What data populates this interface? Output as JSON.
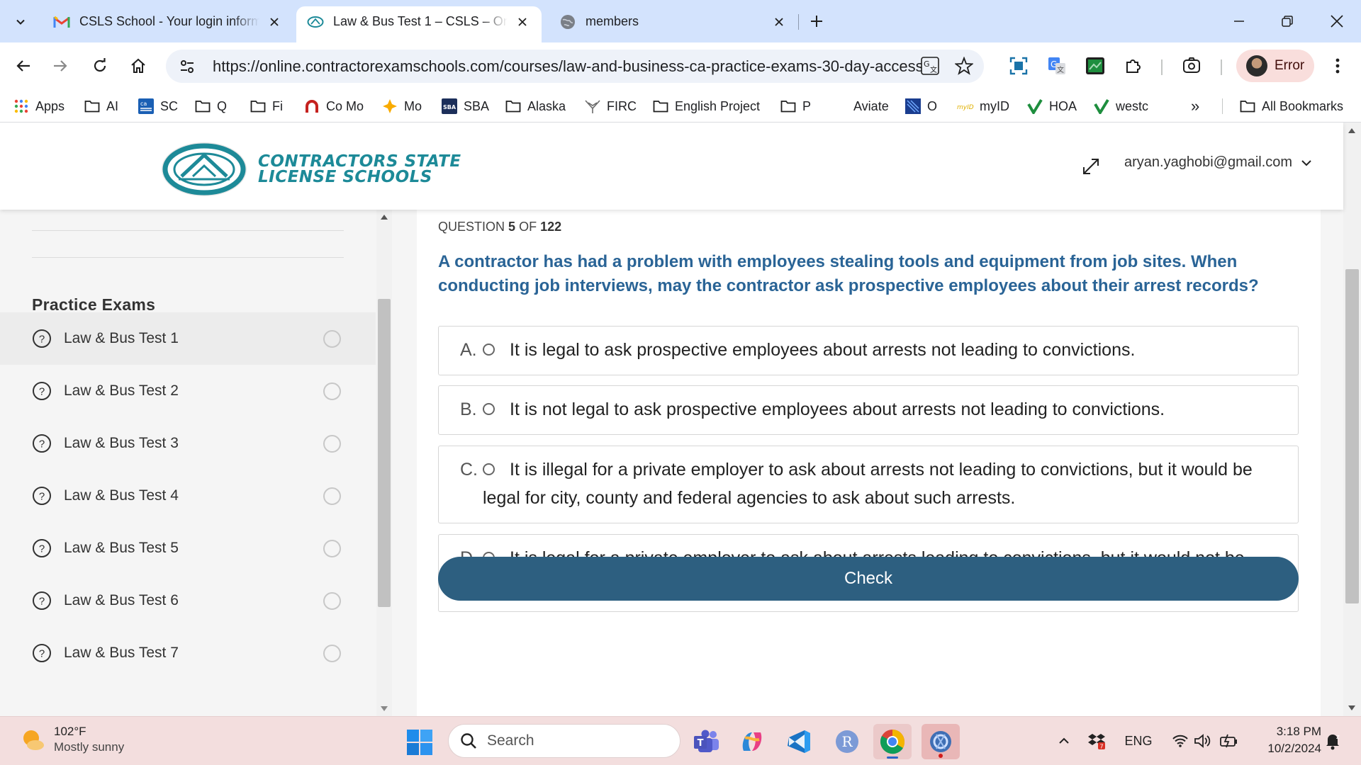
{
  "browser": {
    "tabs": [
      {
        "title": "CSLS School - Your login information"
      },
      {
        "title": "Law & Bus Test 1 – CSLS – Online"
      },
      {
        "title": "members"
      }
    ],
    "url": "https://online.contractorexamschools.com/courses/law-and-business-ca-practice-exams-30-day-access-2...",
    "profile_label": "Error",
    "bookmarks": [
      {
        "label": "Apps",
        "icon": "apps-grid-icon"
      },
      {
        "label": "AI",
        "icon": "folder-icon"
      },
      {
        "label": "SC",
        "icon": "sc-favicon"
      },
      {
        "label": "Q",
        "icon": "folder-icon"
      },
      {
        "label": "Fi",
        "icon": "folder-icon"
      },
      {
        "label": "Co Mo",
        "icon": "como-favicon"
      },
      {
        "label": "Mo",
        "icon": "mo-favicon"
      },
      {
        "label": "SBA",
        "icon": "sba-favicon"
      },
      {
        "label": "Alaska",
        "icon": "folder-icon"
      },
      {
        "label": "FIRC",
        "icon": "firc-favicon"
      },
      {
        "label": "English Project",
        "icon": "folder-icon"
      },
      {
        "label": "P",
        "icon": "folder-icon"
      },
      {
        "label": "Aviate",
        "icon": "none"
      },
      {
        "label": "O",
        "icon": "o-favicon"
      },
      {
        "label": "myID",
        "icon": "myid-favicon"
      },
      {
        "label": "HOA",
        "icon": "checkmark-favicon"
      },
      {
        "label": "westc",
        "icon": "checkmark-favicon"
      }
    ],
    "bookmarks_overflow": "»",
    "all_bookmarks": "All Bookmarks"
  },
  "site": {
    "logo_line1": "CONTRACTORS STATE",
    "logo_line2": "LICENSE SCHOOLS",
    "user_email": "aryan.yaghobi@gmail.com"
  },
  "sidebar": {
    "section_title": "Practice Exams",
    "lessons": [
      {
        "title": "Law & Bus Test 1",
        "current": true
      },
      {
        "title": "Law & Bus Test 2",
        "current": false
      },
      {
        "title": "Law & Bus Test 3",
        "current": false
      },
      {
        "title": "Law & Bus Test 4",
        "current": false
      },
      {
        "title": "Law & Bus Test 5",
        "current": false
      },
      {
        "title": "Law & Bus Test 6",
        "current": false
      },
      {
        "title": "Law & Bus Test 7",
        "current": false
      }
    ]
  },
  "quiz": {
    "counter_prefix": "QUESTION",
    "current": "5",
    "counter_of": "OF",
    "total": "122",
    "question": "A contractor has had a problem with employees stealing tools and equipment from job sites. When conducting job interviews, may the contractor ask prospective employees about their arrest records?",
    "choices": [
      {
        "letter": "A.",
        "text": "It is legal to ask prospective employees about arrests not leading to convictions."
      },
      {
        "letter": "B.",
        "text": "It is not legal to ask prospective employees about arrests not leading to convictions."
      },
      {
        "letter": "C.",
        "text": "It is illegal for a private employer to ask about arrests not leading to convictions, but it would be legal for city, county and federal agencies to ask about such arrests."
      },
      {
        "letter": "D.",
        "text": "It is legal for a private employer to ask about arrests leading to convictions, but it would not be legal for a federal, state, or local public agency to do so."
      }
    ],
    "check_label": "Check"
  },
  "taskbar": {
    "weather_temp": "102°F",
    "weather_condition": "Mostly sunny",
    "search_placeholder": "Search",
    "language": "ENG",
    "time": "3:18 PM",
    "date": "10/2/2024"
  },
  "colors": {
    "question_text": "#2a6496",
    "check_button": "#2d5f80",
    "logo_teal": "#1d8a98",
    "tabstrip": "#d3e3fd",
    "taskbar": "#f3dede"
  }
}
